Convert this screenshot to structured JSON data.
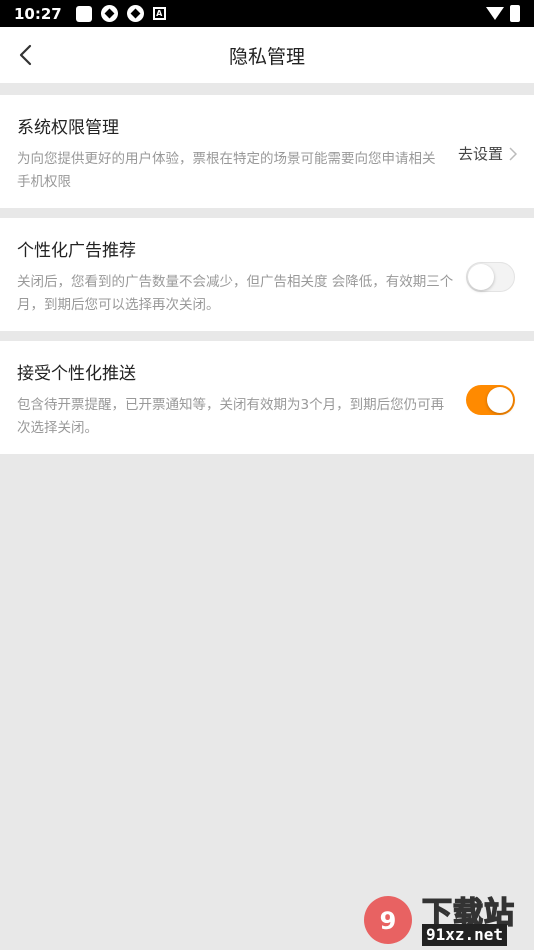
{
  "status_bar": {
    "time": "10:27"
  },
  "header": {
    "title": "隐私管理"
  },
  "sections": [
    {
      "title": "系统权限管理",
      "desc": "为向您提供更好的用户体验，票根在特定的场景可能需要向您申请相关手机权限",
      "action_label": "去设置"
    },
    {
      "title": "个性化广告推荐",
      "desc": "关闭后，您看到的广告数量不会减少，但广告相关度 会降低，有效期三个月，到期后您可以选择再次关闭。",
      "toggle_on": false
    },
    {
      "title": "接受个性化推送",
      "desc": "包含待开票提醒，已开票通知等，关闭有效期为3个月，到期后您仍可再次选择关闭。",
      "toggle_on": true
    }
  ],
  "watermark": {
    "title": "下载站",
    "site": "91xz.net"
  },
  "colors": {
    "accent": "#ff8a00",
    "background": "#e8e8e8"
  }
}
